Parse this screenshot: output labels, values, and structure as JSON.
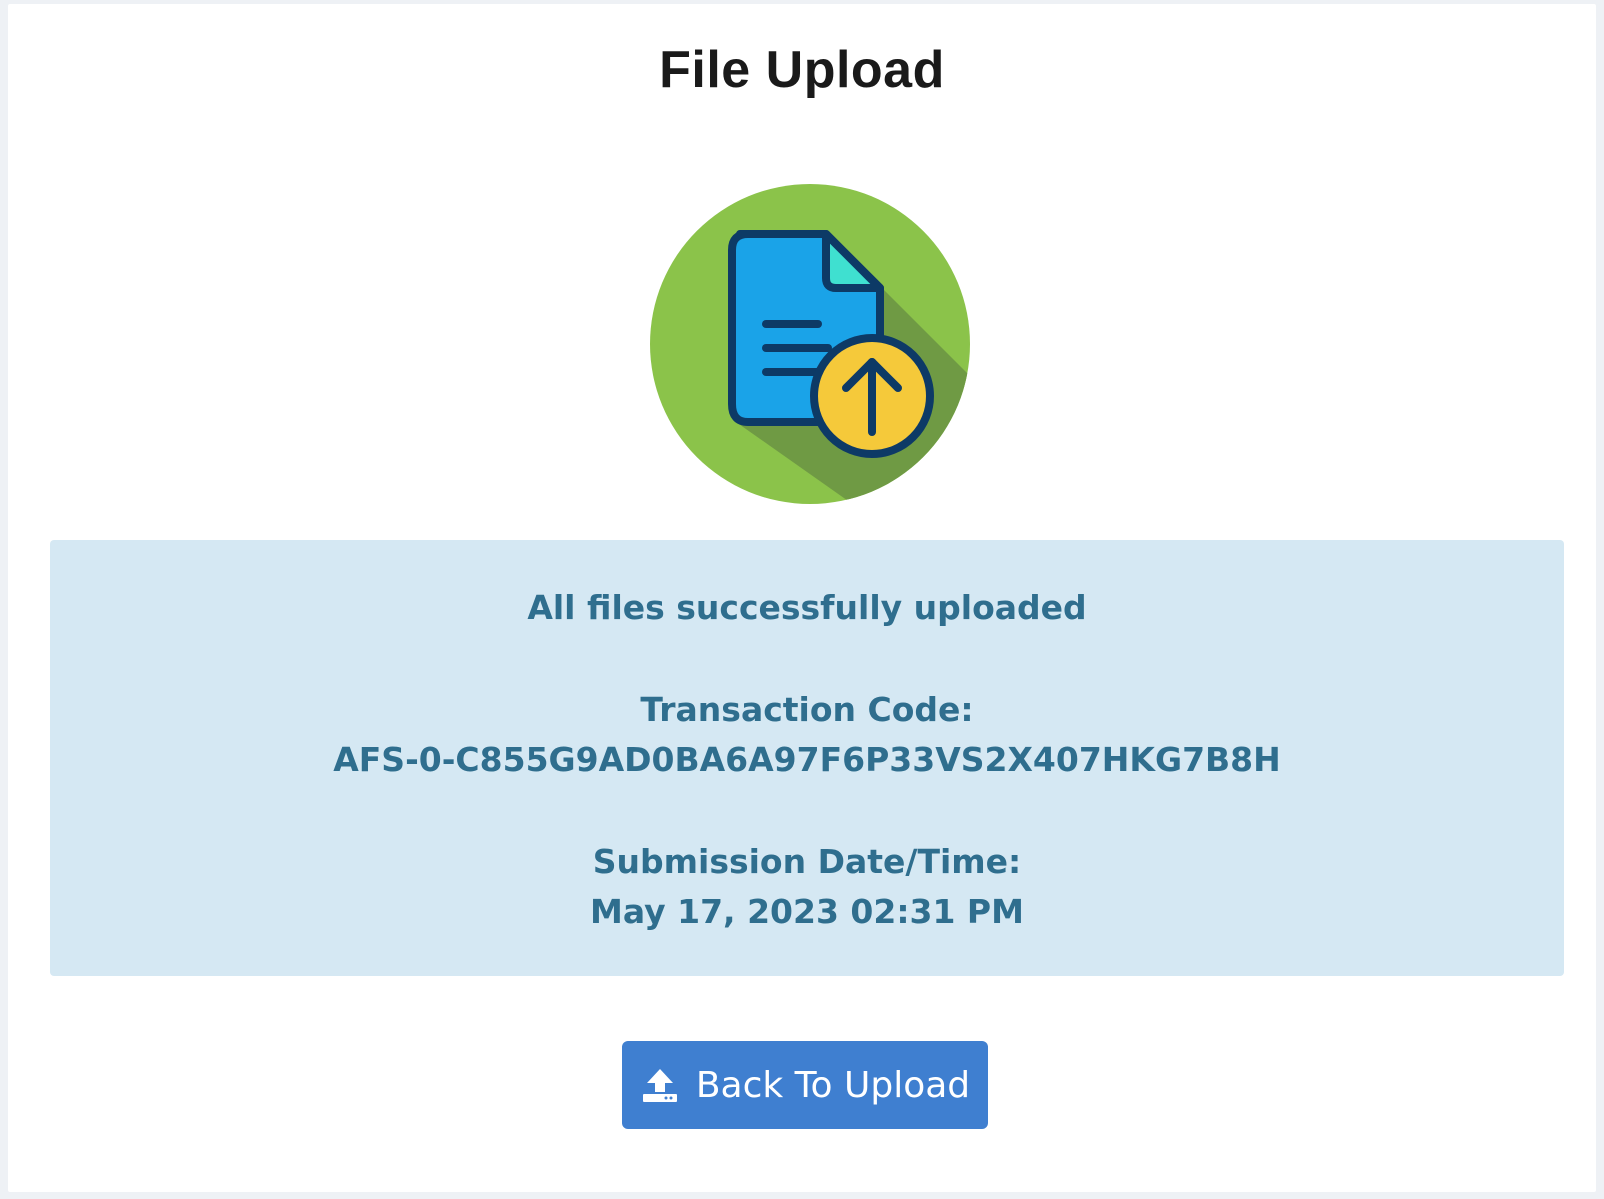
{
  "page": {
    "title": "File Upload"
  },
  "icon": {
    "name": "file-upload-icon",
    "colors": {
      "circle": "#8bc34a",
      "shadow": "#6f9a44",
      "document": "#1aa3e8",
      "document_outline": "#0d3a66",
      "corner": "#3fe0d0",
      "badge": "#f5c93a"
    }
  },
  "alert": {
    "message": "All files successfully uploaded",
    "transaction_label": "Transaction Code:",
    "transaction_code": "AFS-0-C855G9AD0BA6A97F6P33VS2X407HKG7B8H",
    "submission_label": "Submission Date/Time:",
    "submission_datetime": "May 17, 2023 02:31 PM",
    "colors": {
      "background": "#d5e8f3",
      "text": "#2f6e8e"
    }
  },
  "actions": {
    "back_to_upload": {
      "label": "Back To Upload",
      "icon": "upload-icon",
      "color": "#3f7fd0"
    }
  }
}
